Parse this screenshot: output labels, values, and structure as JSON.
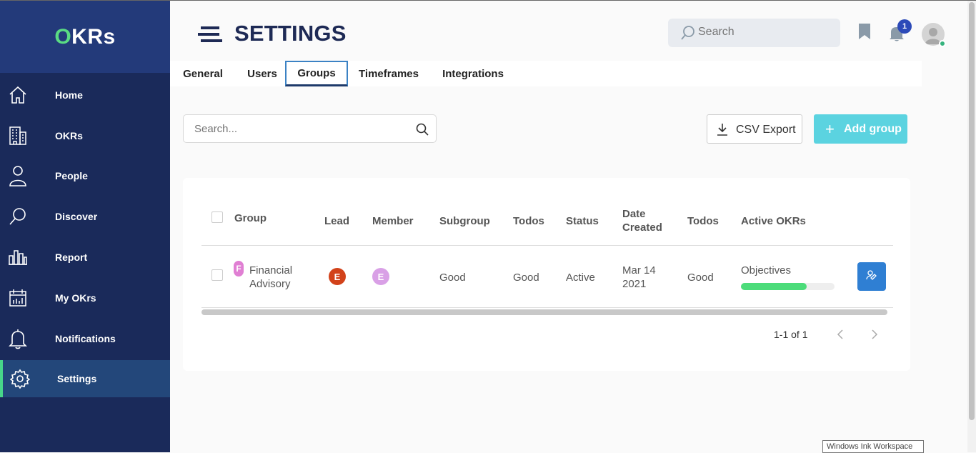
{
  "brand": {
    "first_letter": "O",
    "rest": "KRs"
  },
  "sidebar": {
    "items": [
      {
        "label": "Home",
        "icon": "home-icon"
      },
      {
        "label": "OKRs",
        "icon": "building-icon"
      },
      {
        "label": "People",
        "icon": "person-icon"
      },
      {
        "label": "Discover",
        "icon": "search-icon"
      },
      {
        "label": "Report",
        "icon": "bar-chart-icon"
      },
      {
        "label": "My OKrs",
        "icon": "calendar-chart-icon"
      },
      {
        "label": "Notifications",
        "icon": "bell-icon"
      },
      {
        "label": "Settings",
        "icon": "gear-icon",
        "active": true
      }
    ]
  },
  "header": {
    "title": "SETTINGS",
    "search_placeholder": "Search",
    "notification_count": "1"
  },
  "tabs": [
    {
      "label": "General"
    },
    {
      "label": "Users"
    },
    {
      "label": "Groups",
      "active": true
    },
    {
      "label": "Timeframes"
    },
    {
      "label": "Integrations"
    }
  ],
  "toolbar": {
    "search_placeholder": "Search...",
    "csv_label": "CSV Export",
    "add_label": "Add group"
  },
  "table": {
    "columns": {
      "group": "Group",
      "lead": "Lead",
      "member": "Member",
      "subgroup": "Subgroup",
      "todos1": "Todos",
      "status": "Status",
      "date_line1": "Date",
      "date_line2": "Created",
      "todos2": "Todos",
      "active_okrs": "Active OKRs"
    },
    "rows": [
      {
        "group_initial": "F",
        "group_line1": "Financial",
        "group_line2": "Advisory",
        "lead_initial": "E",
        "member_initial": "E",
        "subgroup": "Good",
        "todos1": "Good",
        "status": "Active",
        "date_line1": "Mar 14",
        "date_line2": "2021",
        "todos2": "Good",
        "okr_label": "Objectives",
        "okr_progress": 0.7
      }
    ],
    "pagination": "1-1 of 1"
  },
  "colors": {
    "sidebar_bg": "#1a2a5a",
    "accent_green": "#4cdc7a",
    "lead_avatar": "#d2421a",
    "member_avatar": "#d9a0e6",
    "group_avatar": "#e07fd3",
    "add_button": "#5bd3e0",
    "action_button": "#2f7fd3"
  },
  "tooltip": "Windows Ink Workspace"
}
